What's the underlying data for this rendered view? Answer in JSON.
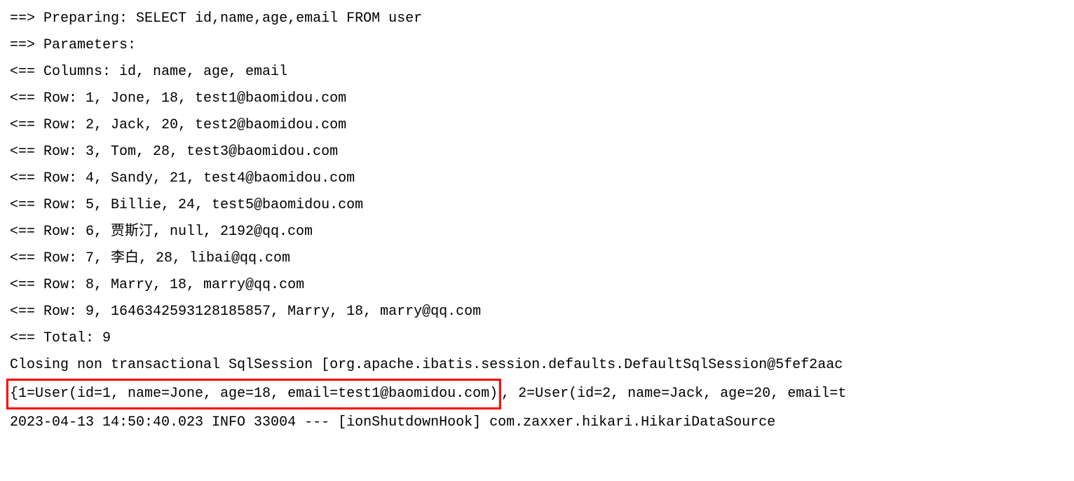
{
  "lines": {
    "l1": "==>  Preparing: SELECT id,name,age,email FROM user ",
    "l2": "==> Parameters: ",
    "l3": "<==    Columns: id, name, age, email",
    "l4": "<==        Row: 1, Jone, 18, test1@baomidou.com",
    "l5": "<==        Row: 2, Jack, 20, test2@baomidou.com",
    "l6": "<==        Row: 3, Tom, 28, test3@baomidou.com",
    "l7": "<==        Row: 4, Sandy, 21, test4@baomidou.com",
    "l8": "<==        Row: 5, Billie, 24, test5@baomidou.com",
    "l9": "<==        Row: 6, 贾斯汀, null, 2192@qq.com",
    "l10": "<==        Row: 7, 李白, 28, libai@qq.com",
    "l11": "<==        Row: 8, Marry, 18, marry@qq.com",
    "l12": "<==        Row: 9, 1646342593128185857, Marry, 18, marry@qq.com",
    "l13": "<==      Total: 9",
    "l14": "Closing non transactional SqlSession [org.apache.ibatis.session.defaults.DefaultSqlSession@5fef2aac",
    "l15_boxed": "{1=User(id=1, name=Jone, age=18, email=test1@baomidou.com)",
    "l15_rest": ", 2=User(id=2, name=Jack, age=20, email=t",
    "l16": "2023-04-13 14:50:40.023  INFO 33004 --- [ionShutdownHook] com.zaxxer.hikari.HikariDataSource"
  }
}
